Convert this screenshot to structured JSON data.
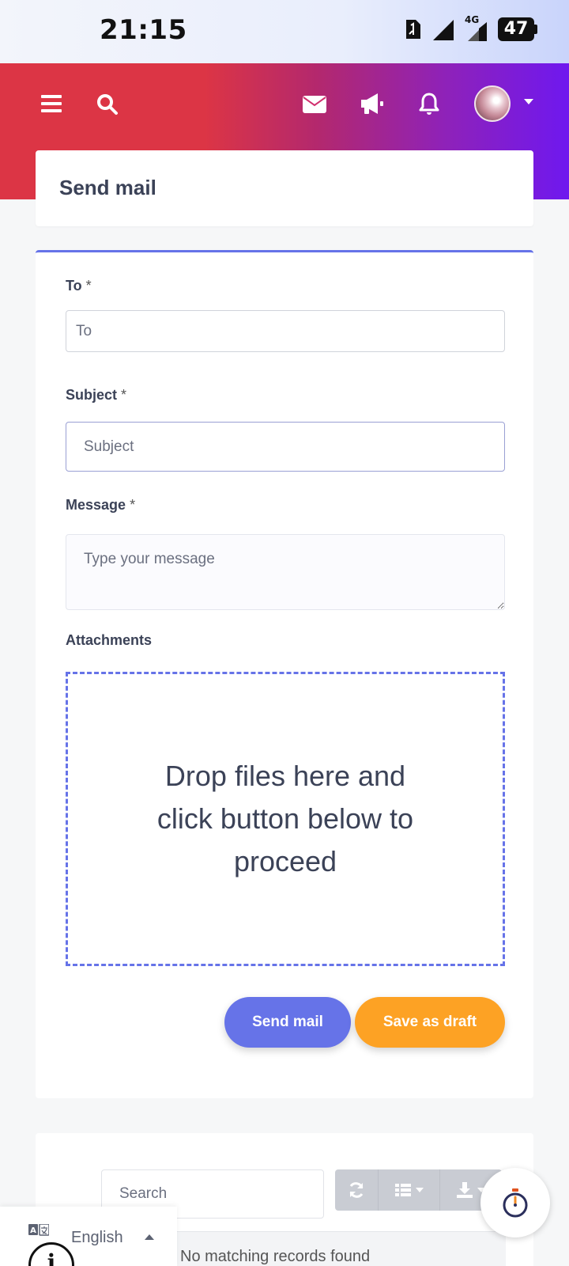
{
  "status_bar": {
    "time": "21:15",
    "network": "4G",
    "battery": "47"
  },
  "topbar": {
    "icons": [
      "menu-icon",
      "search-icon",
      "mail-icon",
      "megaphone-icon",
      "bell-icon",
      "avatar",
      "chevron-down-icon"
    ]
  },
  "page": {
    "title": "Send mail"
  },
  "form": {
    "to": {
      "label": "To",
      "required_mark": "*",
      "placeholder": "To",
      "value": ""
    },
    "subject": {
      "label": "Subject",
      "required_mark": "*",
      "placeholder": "Subject",
      "value": ""
    },
    "message": {
      "label": "Message",
      "required_mark": "*",
      "placeholder": "Type your message",
      "value": ""
    },
    "attachments": {
      "label": "Attachments",
      "dropzone_text": "Drop files here and click button below to proceed"
    },
    "buttons": {
      "send": "Send mail",
      "draft": "Save as draft"
    }
  },
  "table": {
    "search_placeholder": "Search",
    "toolbar": [
      "refresh-icon",
      "columns-icon",
      "download-icon"
    ],
    "empty_text": "No matching records found"
  },
  "language": {
    "current": "English"
  },
  "colors": {
    "primary": "#6673e8",
    "warning": "#fda224",
    "danger": "#dc3545",
    "purple": "#6f18ef"
  }
}
